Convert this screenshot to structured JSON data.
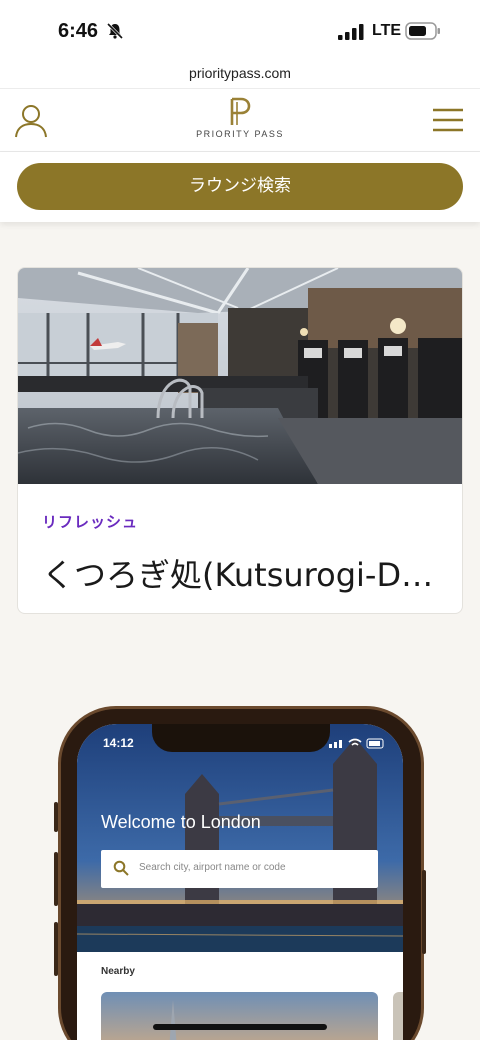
{
  "status": {
    "time": "6:46",
    "network": "LTE"
  },
  "browser": {
    "url": "prioritypass.com"
  },
  "header": {
    "logo_text": "PRIORITY PASS",
    "logo_mark": "P"
  },
  "search": {
    "button_label": "ラウンジ検索"
  },
  "card": {
    "category": "リフレッシュ",
    "title": "くつろぎ処(Kutsurogi-Dokoro)"
  },
  "phone_mock": {
    "time": "14:12",
    "welcome": "Welcome to London",
    "search_placeholder": "Search city, airport name or code",
    "nearby_label": "Nearby"
  },
  "colors": {
    "brand_gold": "#8c7628",
    "category_purple": "#6a2bbf",
    "page_bg": "#f7f5f1"
  },
  "icons": [
    "bell-slash-icon",
    "signal-icon",
    "battery-icon",
    "user-icon",
    "hamburger-menu-icon",
    "search-icon"
  ]
}
